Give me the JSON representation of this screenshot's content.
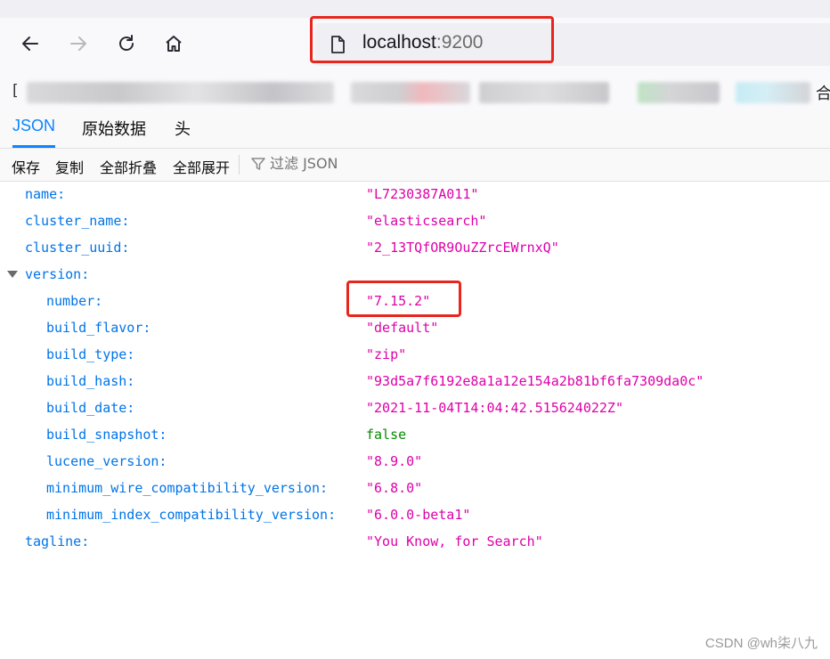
{
  "browser": {
    "url_host": "localhost",
    "url_port": ":9200",
    "bookmarks_first_glyph": "[",
    "bookmarks_last_glyph": "合"
  },
  "viewer": {
    "tabs": [
      {
        "label": "JSON",
        "selected": true
      },
      {
        "label": "原始数据",
        "selected": false
      },
      {
        "label": "头",
        "selected": false
      }
    ],
    "toolbar": {
      "save": "保存",
      "copy": "复制",
      "collapse_all": "全部折叠",
      "expand_all": "全部展开",
      "filter_placeholder": "过滤 JSON"
    },
    "rows": [
      {
        "key": "name:",
        "value": "\"L7230387A011\"",
        "type": "string",
        "indent": 0
      },
      {
        "key": "cluster_name:",
        "value": "\"elasticsearch\"",
        "type": "string",
        "indent": 0
      },
      {
        "key": "cluster_uuid:",
        "value": "\"2_13TQfOR9OuZZrcEWrnxQ\"",
        "type": "string",
        "indent": 0
      },
      {
        "key": "version:",
        "value": "",
        "type": "object",
        "indent": 0,
        "expanded": true
      },
      {
        "key": "number:",
        "value": "\"7.15.2\"",
        "type": "string",
        "indent": 1
      },
      {
        "key": "build_flavor:",
        "value": "\"default\"",
        "type": "string",
        "indent": 1
      },
      {
        "key": "build_type:",
        "value": "\"zip\"",
        "type": "string",
        "indent": 1
      },
      {
        "key": "build_hash:",
        "value": "\"93d5a7f6192e8a1a12e154a2b81bf6fa7309da0c\"",
        "type": "string",
        "indent": 1
      },
      {
        "key": "build_date:",
        "value": "\"2021-11-04T14:04:42.515624022Z\"",
        "type": "string",
        "indent": 1
      },
      {
        "key": "build_snapshot:",
        "value": "false",
        "type": "bool",
        "indent": 1
      },
      {
        "key": "lucene_version:",
        "value": "\"8.9.0\"",
        "type": "string",
        "indent": 1
      },
      {
        "key": "minimum_wire_compatibility_version:",
        "value": "\"6.8.0\"",
        "type": "string",
        "indent": 1
      },
      {
        "key": "minimum_index_compatibility_version:",
        "value": "\"6.0.0-beta1\"",
        "type": "string",
        "indent": 1
      },
      {
        "key": "tagline:",
        "value": "\"You Know, for Search\"",
        "type": "string",
        "indent": 0
      }
    ]
  },
  "colors": {
    "key": "#0074e8",
    "string": "#dd00a9",
    "bool": "#058b00",
    "highlight": "#e8261e",
    "selected_tab": "#0a84ff"
  },
  "icons": [
    "back-arrow-icon",
    "forward-arrow-icon",
    "reload-icon",
    "home-icon",
    "page-icon",
    "filter-funnel-icon",
    "expand-triangle-icon"
  ],
  "watermark": "CSDN @wh柒八九"
}
